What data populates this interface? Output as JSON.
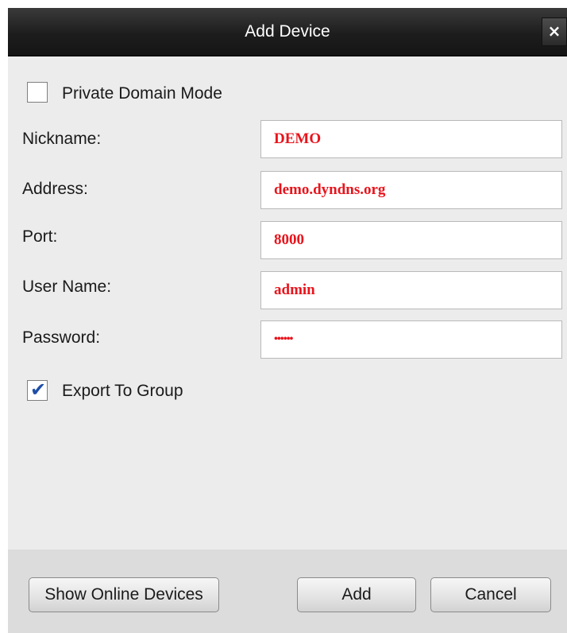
{
  "window": {
    "title": "Add Device",
    "close_icon": "close-icon",
    "close_glyph": "×"
  },
  "form": {
    "private_domain": {
      "label": "Private Domain Mode",
      "checked": false
    },
    "fields": [
      {
        "label": "Nickname:",
        "value": "DEMO"
      },
      {
        "label": "Address:",
        "value": "demo.dyndns.org"
      },
      {
        "label": "Port:",
        "value": "8000"
      },
      {
        "label": "User Name:",
        "value": "admin"
      },
      {
        "label": "Password:",
        "value": "••••••"
      }
    ],
    "export_to_group": {
      "label": "Export To Group",
      "checked": true,
      "check_glyph": "✔"
    }
  },
  "buttons": {
    "show_online_devices": "Show Online Devices",
    "add": "Add",
    "cancel": "Cancel"
  },
  "colors": {
    "field_text": "#e8141c",
    "titlebar": "#1d1d1d",
    "checkmark": "#1f4ea8"
  }
}
